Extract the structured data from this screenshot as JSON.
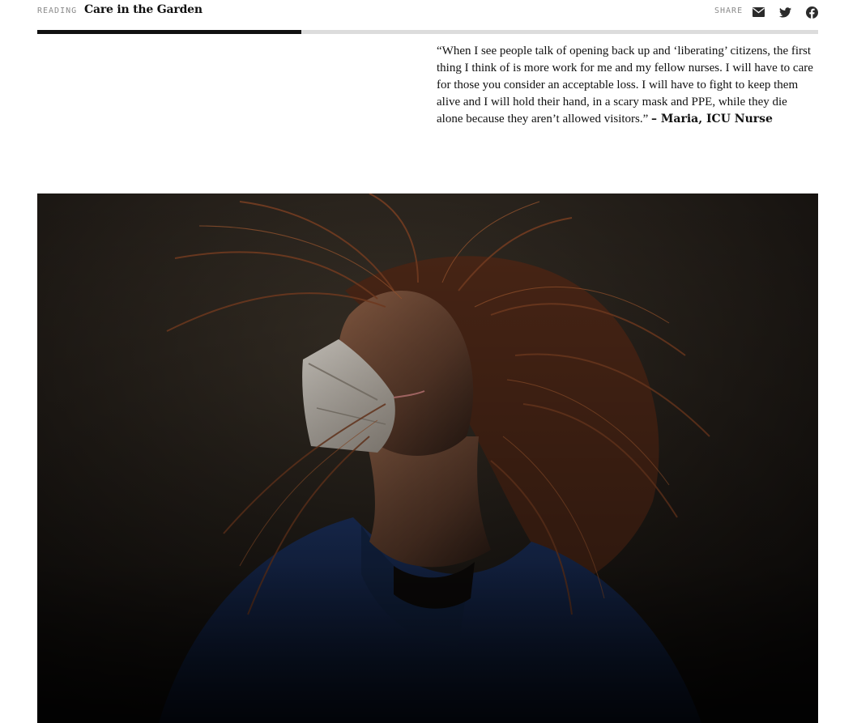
{
  "header": {
    "reading_kicker": "READING",
    "reading_title": "Care in the Garden",
    "share_kicker": "SHARE",
    "share_buttons": [
      {
        "name": "email",
        "icon": "envelope-icon"
      },
      {
        "name": "twitter",
        "icon": "twitter-bird-icon"
      },
      {
        "name": "facebook",
        "icon": "facebook-f-icon"
      }
    ]
  },
  "progress": {
    "fraction": 0.338,
    "fill_color": "#111111",
    "track_color": "#dcdcdc"
  },
  "quote": {
    "text": "“When I see people talk of opening back up and ‘liberating’ citizens, the first thing I think of is more work for me and my fellow nurses. I will have to care for those you consider an acceptable loss. I will have to fight to keep them alive and I will hold their hand, in a scary mask and PPE, while they die alone because they aren’t allowed visitors.”",
    "attribution": "– Maria, ICU Nurse"
  },
  "photo": {
    "icon": "photo-nurse-in-mask"
  }
}
